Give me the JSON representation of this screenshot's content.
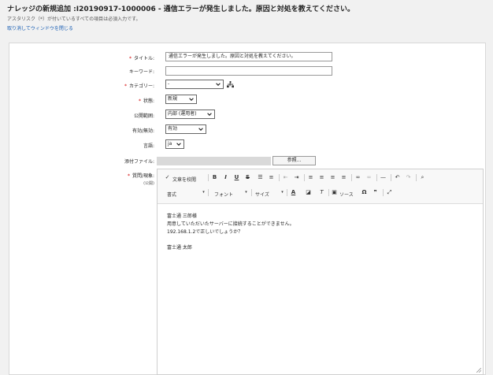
{
  "header": {
    "title": "ナレッジの新規追加 :I20190917-1000006 - 通信エラーが発生しました。原因と対処を教えてください。",
    "note": "アスタリスク（*）が付いているすべての項目は必須入力です。",
    "close_link": "取り消してウィンドウを閉じる"
  },
  "form": {
    "title_label": "タイトル:",
    "title_value": "通信エラーが発生しました。原因と対処を教えてください。",
    "keyword_label": "キーワード:",
    "keyword_value": "",
    "category_label": "カテゴリー:",
    "category_value": "-",
    "status_label": "状態:",
    "status_value": "新規",
    "scope_label": "公開範囲:",
    "scope_value": "内部 (運用者)",
    "valid_label": "有効/無効:",
    "valid_value": "有効",
    "lang_label": "言語:",
    "lang_value": "ja",
    "attach_label": "添付ファイル:",
    "browse_label": "参照...",
    "question_label": "質問/現象:",
    "question_sub": "(公開)",
    "required_mark": "*"
  },
  "editor": {
    "spellcheck": "文章を校閲",
    "bold": "B",
    "italic": "I",
    "underline": "U",
    "strike": "S",
    "format_label": "書式",
    "font_label": "フォント",
    "size_label": "サイズ",
    "source_label": "ソース",
    "content_lines": [
      "富士通 三郎様",
      "用意していただいたサーバーに接続することができません。",
      "192.168.1.2で正しいでしょうか？",
      "",
      "富士通 太郎"
    ]
  },
  "colors": {
    "required": "#d10000",
    "link": "#1a5fb4",
    "background": "#f1f1f1"
  },
  "icons": [
    "org-tree-icon",
    "spellcheck-icon",
    "list-icon",
    "indent-icon",
    "align-icon",
    "link-icon",
    "flag-icon",
    "undo-icon",
    "redo-icon",
    "search-icon",
    "omega-icon",
    "quote-icon",
    "maximize-icon",
    "resize-icon"
  ]
}
